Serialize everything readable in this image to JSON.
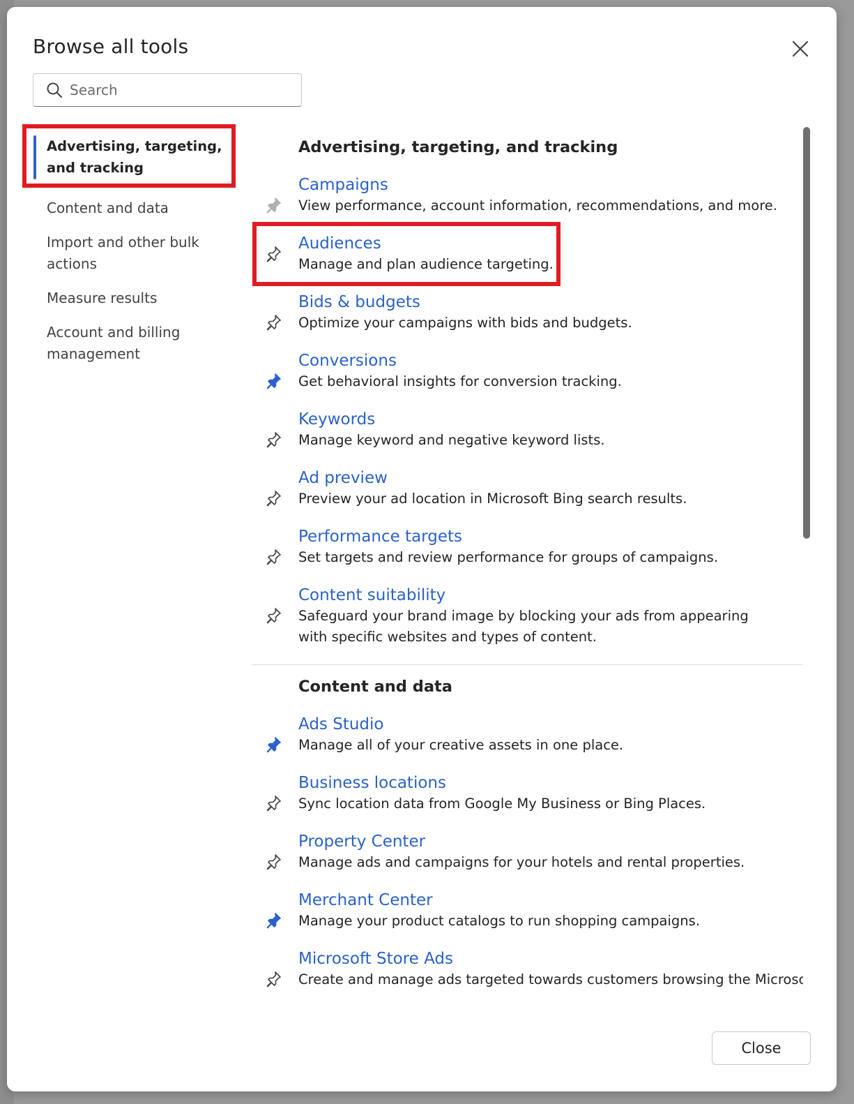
{
  "dialog": {
    "title": "Browse all tools",
    "close_button": "Close"
  },
  "search": {
    "placeholder": "Search"
  },
  "nav": {
    "items": [
      {
        "label": "Advertising, targeting, and tracking",
        "active": true
      },
      {
        "label": "Content and data"
      },
      {
        "label": "Import and other bulk actions"
      },
      {
        "label": "Measure results"
      },
      {
        "label": "Account and billing management"
      }
    ]
  },
  "sections": [
    {
      "title": "Advertising, targeting, and tracking",
      "tools": [
        {
          "name": "Campaigns",
          "desc": "View performance, account information, recommendations, and more.",
          "pin": "pinned-gray"
        },
        {
          "name": "Audiences",
          "desc": "Manage and plan audience targeting.",
          "pin": "unpinned"
        },
        {
          "name": "Bids & budgets",
          "desc": "Optimize your campaigns with bids and budgets.",
          "pin": "unpinned"
        },
        {
          "name": "Conversions",
          "desc": "Get behavioral insights for conversion tracking.",
          "pin": "pinned"
        },
        {
          "name": "Keywords",
          "desc": "Manage keyword and negative keyword lists.",
          "pin": "unpinned"
        },
        {
          "name": "Ad preview",
          "desc": "Preview your ad location in Microsoft Bing search results.",
          "pin": "unpinned"
        },
        {
          "name": "Performance targets",
          "desc": "Set targets and review performance for groups of campaigns.",
          "pin": "unpinned"
        },
        {
          "name": "Content suitability",
          "desc": "Safeguard your brand image by blocking your ads from appearing with specific websites and types of content.",
          "pin": "unpinned"
        }
      ]
    },
    {
      "title": "Content and data",
      "tools": [
        {
          "name": "Ads Studio",
          "desc": "Manage all of your creative assets in one place.",
          "pin": "pinned"
        },
        {
          "name": "Business locations",
          "desc": "Sync location data from Google My Business or Bing Places.",
          "pin": "unpinned"
        },
        {
          "name": "Property Center",
          "desc": "Manage ads and campaigns for your hotels and rental properties.",
          "pin": "unpinned"
        },
        {
          "name": "Merchant Center",
          "desc": "Manage your product catalogs to run shopping campaigns.",
          "pin": "pinned"
        },
        {
          "name": "Microsoft Store Ads",
          "desc": "Create and manage ads targeted towards customers browsing the Microsoft",
          "pin": "unpinned"
        }
      ]
    }
  ],
  "colors": {
    "accent": "#2a62c9",
    "highlight_box": "#e01b22",
    "pinned_gray": "#b0b0b0"
  },
  "icons": {
    "close": "close-icon",
    "search": "search-icon",
    "pin": "pin-icon"
  }
}
